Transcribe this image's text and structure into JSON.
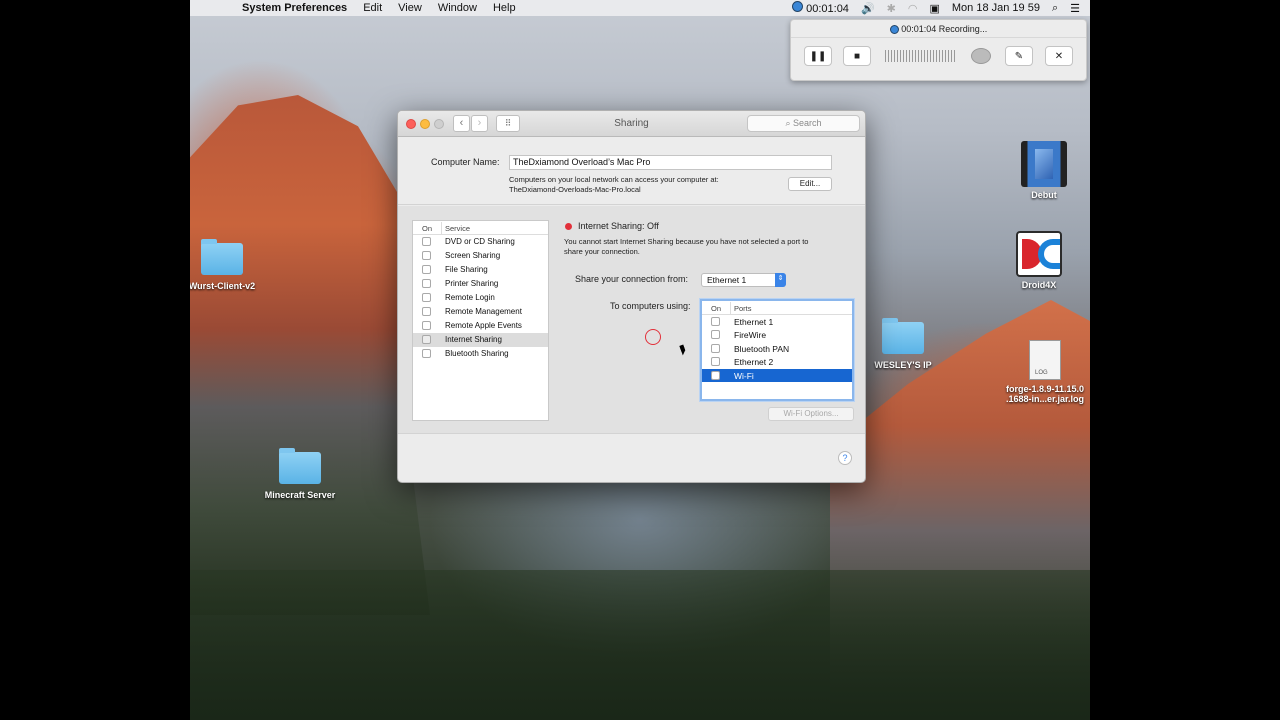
{
  "menubar": {
    "apple": "",
    "app": "System Preferences",
    "items": [
      "Edit",
      "View",
      "Window",
      "Help"
    ],
    "rec_time": "00:01:04",
    "clock": "Mon 18 Jan  19 59"
  },
  "recorder": {
    "title": "00:01:04 Recording...",
    "pause": "❚❚",
    "stop": "■",
    "edit": "✎",
    "close": "✕"
  },
  "desktop": {
    "wurst": "Wurst-Client-v2",
    "minecraft": "Minecraft Server",
    "debut": "Debut",
    "droid": "Droid4X",
    "wesley": "WESLEY'S IP",
    "forge_line1": "forge-1.8.9-11.15.0",
    "forge_line2": ".1688-in...er.jar.log",
    "log_badge": "LOG"
  },
  "window": {
    "title": "Sharing",
    "search_placeholder": "Search",
    "computer_name_label": "Computer Name:",
    "computer_name_value": "TheDxiamond Overload’s Mac Pro",
    "local_info_line1": "Computers on your local network can access your computer at:",
    "local_info_line2": "TheDxiamond-Overloads-Mac-Pro.local",
    "edit_button": "Edit...",
    "services_header_on": "On",
    "services_header_service": "Service",
    "services": [
      "DVD or CD Sharing",
      "Screen Sharing",
      "File Sharing",
      "Printer Sharing",
      "Remote Login",
      "Remote Management",
      "Remote Apple Events",
      "Internet Sharing",
      "Bluetooth Sharing"
    ],
    "status_title": "Internet Sharing: Off",
    "status_desc_line1": "You cannot start Internet Sharing because you have not selected a port to",
    "status_desc_line2": "share your connection.",
    "share_from_label": "Share your connection from:",
    "share_from_value": "Ethernet 1",
    "to_computers_label": "To computers using:",
    "ports_header_on": "On",
    "ports_header_ports": "Ports",
    "ports": [
      "Ethernet 1",
      "FireWire",
      "Bluetooth PAN",
      "Ethernet 2",
      "Wi-Fi"
    ],
    "wifi_options": "Wi-Fi Options...",
    "help": "?"
  },
  "colors": {
    "selection_blue": "#1766d1",
    "status_red": "#e2303a"
  }
}
